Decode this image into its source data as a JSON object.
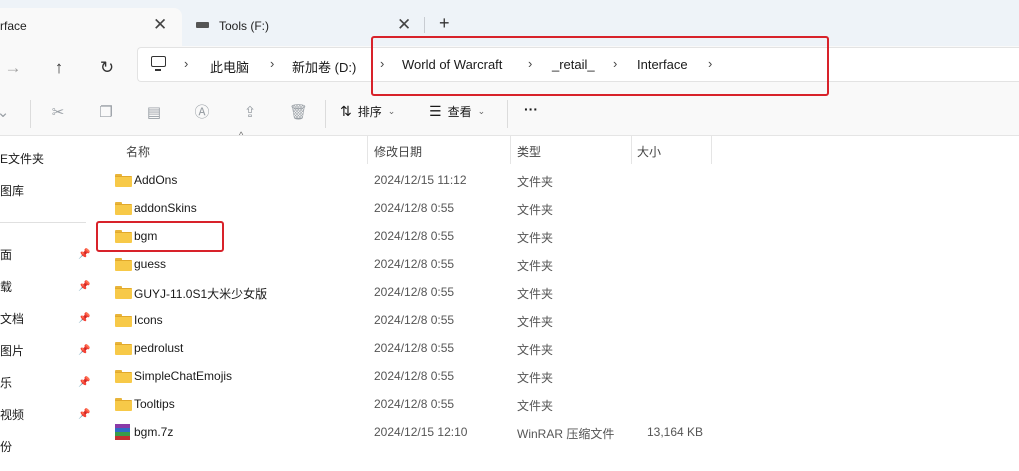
{
  "tabs": [
    {
      "title": "rface",
      "close": "✕"
    },
    {
      "title": "Tools (F:)",
      "close": "✕"
    }
  ],
  "new_tab": "+",
  "nav": {
    "forward": "→",
    "up": "↑",
    "refresh": "↻"
  },
  "breadcrumb": [
    "此电脑",
    "新加卷 (D:)",
    "World of Warcraft",
    "_retail_",
    "Interface"
  ],
  "breadcrumb_sep": "›",
  "commands": {
    "sort_label": "排序",
    "view_label": "查看",
    "more_label": "···"
  },
  "sidebar": {
    "items": [
      "主文件夹",
      "图库",
      "桌面",
      "下载",
      "文档",
      "图片",
      "音乐",
      "视频",
      "备份"
    ],
    "visible": [
      "E文件夹",
      "图库",
      "面",
      "载",
      "文档",
      "图片",
      "乐",
      "视频",
      "份"
    ],
    "pin": "📌"
  },
  "columns": {
    "name": "名称",
    "date": "修改日期",
    "type": "类型",
    "size": "大小"
  },
  "sort_caret": "^",
  "files": [
    {
      "name": "AddOns",
      "date": "2024/12/15 11:12",
      "type": "文件夹",
      "size": "",
      "kind": "folder"
    },
    {
      "name": "addonSkins",
      "date": "2024/12/8 0:55",
      "type": "文件夹",
      "size": "",
      "kind": "folder"
    },
    {
      "name": "bgm",
      "date": "2024/12/8 0:55",
      "type": "文件夹",
      "size": "",
      "kind": "folder"
    },
    {
      "name": "guess",
      "date": "2024/12/8 0:55",
      "type": "文件夹",
      "size": "",
      "kind": "folder"
    },
    {
      "name": "GUYJ-11.0S1大米少女版",
      "date": "2024/12/8 0:55",
      "type": "文件夹",
      "size": "",
      "kind": "folder"
    },
    {
      "name": "Icons",
      "date": "2024/12/8 0:55",
      "type": "文件夹",
      "size": "",
      "kind": "folder"
    },
    {
      "name": "pedrolust",
      "date": "2024/12/8 0:55",
      "type": "文件夹",
      "size": "",
      "kind": "folder"
    },
    {
      "name": "SimpleChatEmojis",
      "date": "2024/12/8 0:55",
      "type": "文件夹",
      "size": "",
      "kind": "folder"
    },
    {
      "name": "Tooltips",
      "date": "2024/12/8 0:55",
      "type": "文件夹",
      "size": "",
      "kind": "folder"
    },
    {
      "name": "bgm.7z",
      "date": "2024/12/15 12:10",
      "type": "WinRAR 压缩文件",
      "size": "13,164 KB",
      "kind": "rar"
    }
  ],
  "colors": {
    "highlight": "#d8222a",
    "folder": "#f7c948"
  }
}
